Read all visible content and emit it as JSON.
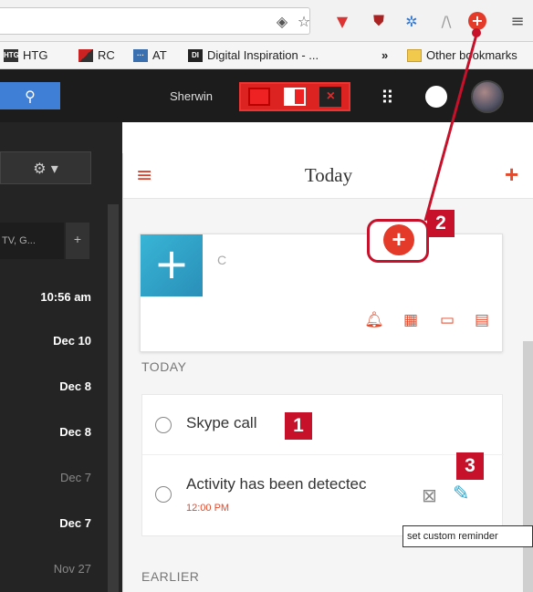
{
  "browser": {
    "bookmarks": [
      {
        "label": "HTG",
        "icon": "htg-favicon"
      },
      {
        "label": "RC",
        "icon": "rc-favicon"
      },
      {
        "label": "AT",
        "icon": "at-favicon"
      },
      {
        "label": "Digital Inspiration - ...",
        "icon": "di-favicon"
      }
    ],
    "overflow_label": "»",
    "other_bookmarks_label": "Other bookmarks"
  },
  "header": {
    "username": "Sherwin"
  },
  "left": {
    "label": "TV, G...",
    "plus": "+",
    "times": [
      "10:56 am",
      "Dec 10",
      "Dec 8",
      "Dec 8",
      "Dec 7",
      "Dec 7",
      "Nov 27"
    ]
  },
  "panel": {
    "title": "Today",
    "new_task_value": "C",
    "section_today": "TODAY",
    "section_earlier": "EARLIER",
    "tasks": [
      {
        "text": "Skype call"
      },
      {
        "text": "Activity has been detectec",
        "time": "12:00 PM"
      }
    ]
  },
  "tooltip": "set custom reminder",
  "callouts": [
    "1",
    "2",
    "3"
  ],
  "colors": {
    "accent": "#e24a2b",
    "callout": "#c7112a",
    "new_button": "#2a9fc6"
  }
}
